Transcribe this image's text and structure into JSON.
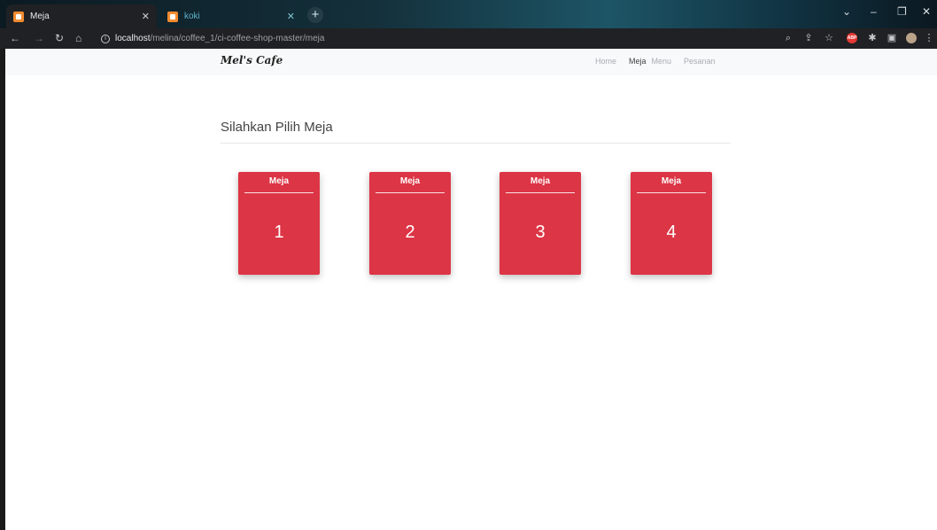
{
  "browser": {
    "tabs": [
      {
        "title": "Meja",
        "active": true
      },
      {
        "title": "koki",
        "active": false
      }
    ],
    "url_host": "localhost",
    "url_path": "/melina/coffee_1/ci-coffee-shop-master/meja"
  },
  "navbar": {
    "brand": "Mel's Cafe",
    "links": [
      "Home",
      "Meja",
      "Menu",
      "Pesanan"
    ],
    "active_link": "Meja"
  },
  "main": {
    "heading": "Silahkan Pilih Meja",
    "cards": [
      {
        "label": "Meja",
        "number": "1"
      },
      {
        "label": "Meja",
        "number": "2"
      },
      {
        "label": "Meja",
        "number": "3"
      },
      {
        "label": "Meja",
        "number": "4"
      }
    ]
  },
  "colors": {
    "card": "#dc3545",
    "navbar_bg": "#f8f9fa"
  }
}
